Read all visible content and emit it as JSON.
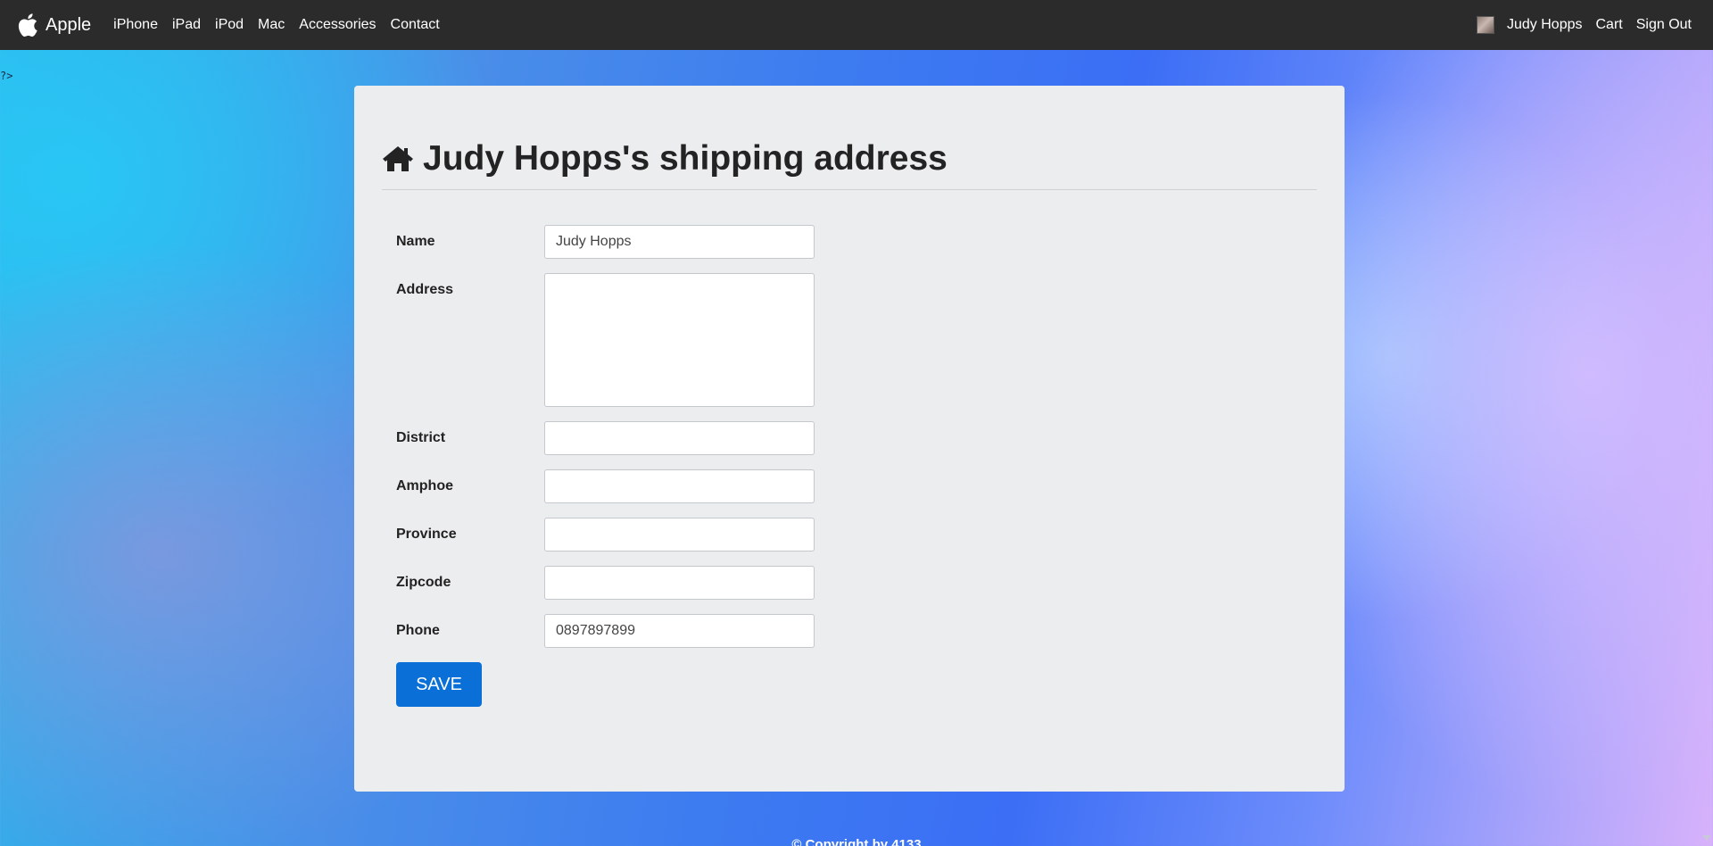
{
  "navbar": {
    "brand": "Apple",
    "links": [
      "iPhone",
      "iPad",
      "iPod",
      "Mac",
      "Accessories",
      "Contact"
    ],
    "user_name": "Judy Hopps",
    "cart": "Cart",
    "sign_out": "Sign Out"
  },
  "stray_text": "?>",
  "page": {
    "title": "Judy Hopps's shipping address"
  },
  "form": {
    "name": {
      "label": "Name",
      "value": "Judy Hopps"
    },
    "address": {
      "label": "Address",
      "value": ""
    },
    "district": {
      "label": "District",
      "value": ""
    },
    "amphoe": {
      "label": "Amphoe",
      "value": ""
    },
    "province": {
      "label": "Province",
      "value": ""
    },
    "zipcode": {
      "label": "Zipcode",
      "value": ""
    },
    "phone": {
      "label": "Phone",
      "value": "0897897899"
    },
    "save_label": "SAVE"
  },
  "footer": {
    "text": "© Copyright by 4133"
  },
  "colors": {
    "navbar": "#2b2b2c",
    "card": "#ecedee",
    "save_button": "#0a6fd6"
  }
}
